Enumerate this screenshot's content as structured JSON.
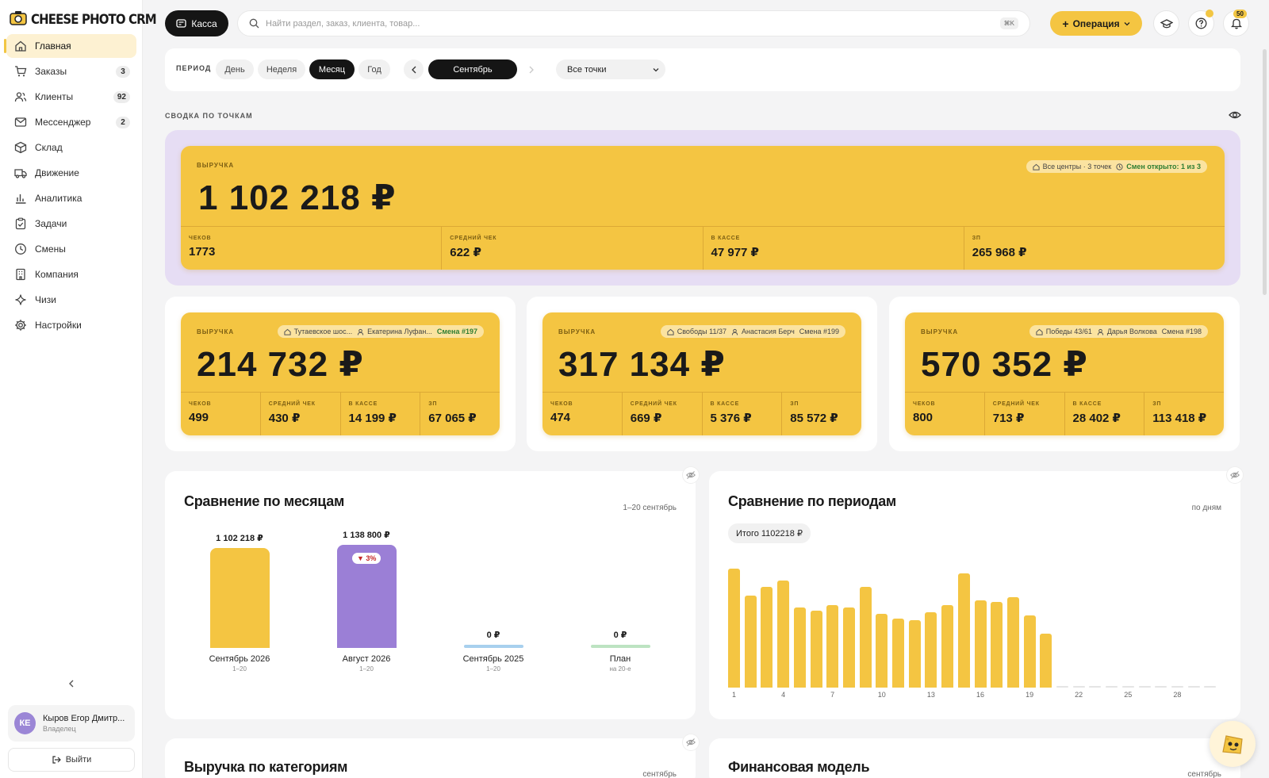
{
  "app": {
    "name": "CHEESE PHOTO CRM"
  },
  "sidebar": {
    "items": [
      {
        "label": "Главная",
        "icon": "home-icon",
        "active": true,
        "badge": ""
      },
      {
        "label": "Заказы",
        "icon": "cart-icon",
        "badge": "3"
      },
      {
        "label": "Клиенты",
        "icon": "users-icon",
        "badge": "92"
      },
      {
        "label": "Мессенджер",
        "icon": "mail-icon",
        "badge": "2"
      },
      {
        "label": "Склад",
        "icon": "box-icon",
        "badge": ""
      },
      {
        "label": "Движение",
        "icon": "truck-icon",
        "badge": ""
      },
      {
        "label": "Аналитика",
        "icon": "bar-chart-icon",
        "badge": ""
      },
      {
        "label": "Задачи",
        "icon": "clipboard-icon",
        "badge": ""
      },
      {
        "label": "Смены",
        "icon": "clock-icon",
        "badge": ""
      },
      {
        "label": "Компания",
        "icon": "building-icon",
        "badge": ""
      },
      {
        "label": "Чизи",
        "icon": "sparkle-icon",
        "badge": ""
      },
      {
        "label": "Настройки",
        "icon": "gear-icon",
        "badge": ""
      }
    ],
    "user": {
      "initials": "КЕ",
      "name": "Кыров Егор Дмитр...",
      "role": "Владелец"
    },
    "logout_label": "Выйти"
  },
  "topbar": {
    "kassa_label": "Касса",
    "search_placeholder": "Найти раздел, заказ, клиента, товар...",
    "shortcut": "⌘K",
    "operation_label": "Операция",
    "notifications_count": "50"
  },
  "filters": {
    "period_label": "ПЕРИОД",
    "periods": [
      "День",
      "Неделя",
      "Месяц",
      "Год"
    ],
    "active_period": "Месяц",
    "month": "Сентябрь",
    "location": "Все точки"
  },
  "summary": {
    "section_title": "СВОДКА ПО ТОЧКАМ",
    "revenue_label": "ВЫРУЧКА",
    "revenue": "1 102 218 ₽",
    "tag_centers": "Все центры · 3 точек",
    "tag_shifts": "Смен открыто: 1 из 3",
    "stats": [
      {
        "label": "ЧЕКОВ",
        "value": "1773"
      },
      {
        "label": "СРЕДНИЙ ЧЕК",
        "value": "622 ₽"
      },
      {
        "label": "В КАССЕ",
        "value": "47 977 ₽"
      },
      {
        "label": "ЗП",
        "value": "265 968 ₽"
      }
    ]
  },
  "points": [
    {
      "revenue_label": "ВЫРУЧКА",
      "revenue": "214 732 ₽",
      "place": "Тутаевское шос...",
      "person": "Екатерина Луфан...",
      "shift": "Смена #197",
      "shift_green": true,
      "stats": [
        {
          "label": "ЧЕКОВ",
          "value": "499"
        },
        {
          "label": "СРЕДНИЙ ЧЕК",
          "value": "430 ₽"
        },
        {
          "label": "В КАССЕ",
          "value": "14 199 ₽"
        },
        {
          "label": "ЗП",
          "value": "67 065 ₽"
        }
      ]
    },
    {
      "revenue_label": "ВЫРУЧКА",
      "revenue": "317 134 ₽",
      "place": "Свободы 11/37",
      "person": "Анастасия Берч",
      "shift": "Смена #199",
      "shift_green": false,
      "stats": [
        {
          "label": "ЧЕКОВ",
          "value": "474"
        },
        {
          "label": "СРЕДНИЙ ЧЕК",
          "value": "669 ₽"
        },
        {
          "label": "В КАССЕ",
          "value": "5 376 ₽"
        },
        {
          "label": "ЗП",
          "value": "85 572 ₽"
        }
      ]
    },
    {
      "revenue_label": "ВЫРУЧКА",
      "revenue": "570 352 ₽",
      "place": "Победы 43/61",
      "person": "Дарья Волкова",
      "shift": "Смена #198",
      "shift_green": false,
      "stats": [
        {
          "label": "ЧЕКОВ",
          "value": "800"
        },
        {
          "label": "СРЕДНИЙ ЧЕК",
          "value": "713 ₽"
        },
        {
          "label": "В КАССЕ",
          "value": "28 402 ₽"
        },
        {
          "label": "ЗП",
          "value": "113 418 ₽"
        }
      ]
    }
  ],
  "chart_data": [
    {
      "type": "bar",
      "title": "Сравнение по месяцам",
      "subtitle": "1–20 сентябрь",
      "categories": [
        "Сентябрь 2026",
        "Август 2026",
        "Сентябрь 2025",
        "План"
      ],
      "category_subs": [
        "1–20",
        "1–20",
        "1–20",
        "на 20-е"
      ],
      "values": [
        1102218,
        1138800,
        0,
        0
      ],
      "value_labels": [
        "1 102 218 ₽",
        "1 138 800 ₽",
        "0 ₽",
        "0 ₽"
      ],
      "badge": "▼ 3%",
      "colors": [
        "#f4c542",
        "#9b7fd6",
        "#a8d0ee",
        "#bde3c2"
      ]
    },
    {
      "type": "bar",
      "title": "Сравнение по периодам",
      "subtitle": "по дням",
      "total": "Итого 1102218 ₽",
      "x": [
        1,
        2,
        3,
        4,
        5,
        6,
        7,
        8,
        9,
        10,
        11,
        12,
        13,
        14,
        15,
        16,
        17,
        18,
        19,
        20,
        21,
        22,
        23,
        24,
        25,
        26,
        27,
        28,
        29,
        30
      ],
      "x_ticks": [
        "1",
        "4",
        "7",
        "10",
        "13",
        "16",
        "19",
        "22",
        "25",
        "28"
      ],
      "values": [
        71000,
        55000,
        60000,
        64000,
        48000,
        46000,
        49000,
        48000,
        60000,
        44000,
        41000,
        40000,
        45000,
        49000,
        68000,
        52000,
        51000,
        54000,
        43000,
        32000,
        0,
        0,
        0,
        0,
        0,
        0,
        0,
        0,
        0,
        0
      ],
      "color": "#f4c542"
    }
  ],
  "bottom": {
    "left_title": "Выручка по категориям",
    "left_sub": "сентябрь",
    "right_title": "Финансовая модель",
    "right_sub": "сентябрь"
  }
}
